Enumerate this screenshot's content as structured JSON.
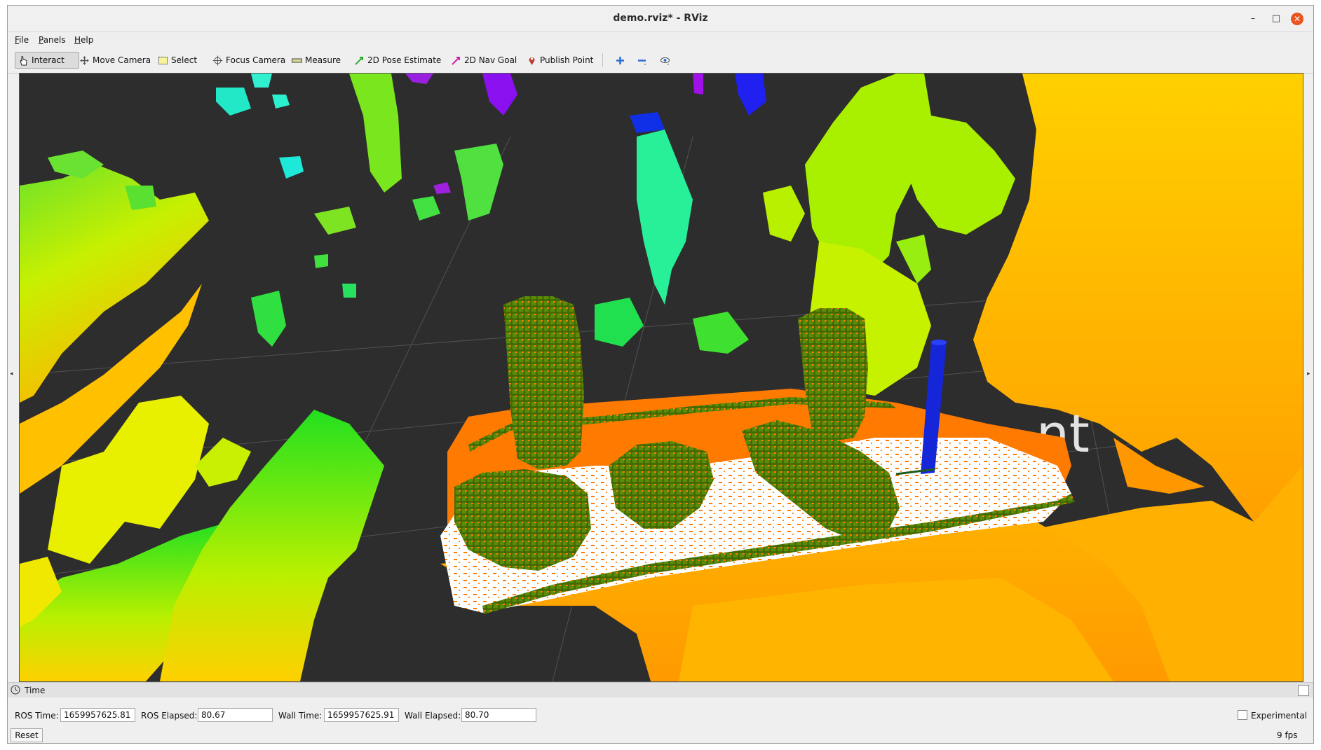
{
  "window": {
    "title": "demo.rviz* - RViz",
    "minimize": "–",
    "maximize": "□",
    "close": "✕"
  },
  "menu": [
    {
      "label": "File",
      "key": "F",
      "rest": "ile"
    },
    {
      "label": "Panels",
      "key": "P",
      "rest": "anels"
    },
    {
      "label": "Help",
      "key": "H",
      "rest": "elp"
    }
  ],
  "toolbar": {
    "interact": "Interact",
    "move_camera": "Move Camera",
    "select": "Select",
    "focus_camera": "Focus Camera",
    "measure": "Measure",
    "pose_estimate": "2D Pose Estimate",
    "nav_goal": "2D Nav Goal",
    "publish_point": "Publish Point"
  },
  "viewport": {
    "overlay_text": "nt"
  },
  "time_panel": {
    "title": "Time",
    "ros_time_label": "ROS Time:",
    "ros_time": "1659957625.81",
    "ros_elapsed_label": "ROS Elapsed:",
    "ros_elapsed": "80.67",
    "wall_time_label": "Wall Time:",
    "wall_time": "1659957625.91",
    "wall_elapsed_label": "Wall Elapsed:",
    "wall_elapsed": "80.70",
    "experimental_label": "Experimental",
    "reset_label": "Reset",
    "fps": "9 fps"
  },
  "colors": {
    "accent_close": "#e95420",
    "view_bg": "#2d2d2d",
    "table": "#ff7a00",
    "voxel": "#4a7a00",
    "pole": "#1020d0"
  }
}
